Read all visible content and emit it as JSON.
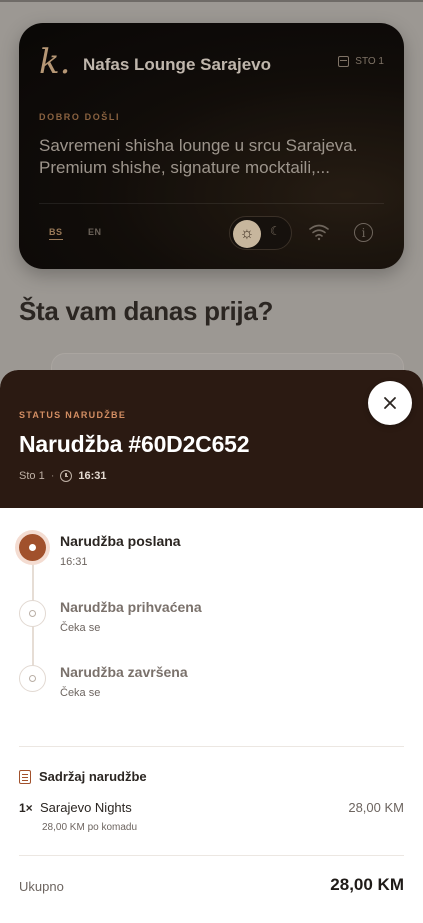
{
  "venue": {
    "logo": "k.",
    "name": "Nafas Lounge Sarajevo",
    "table_tag": "STO 1",
    "welcome_eyebrow": "DOBRO DOŠLI",
    "description": "Savremeni shisha lounge u srcu Sarajeva. Premium shishe, signature mocktaili,...",
    "languages": [
      "BS",
      "EN"
    ],
    "active_language": "BS",
    "theme": "light"
  },
  "page": {
    "heading": "Šta vam danas prija?"
  },
  "order": {
    "eyebrow": "STATUS NARUDŽBE",
    "title": "Narudžba #60D2C652",
    "table": "Sto 1",
    "separator": "·",
    "time": "16:31",
    "steps": [
      {
        "title": "Narudžba poslana",
        "sub": "16:31",
        "state": "done"
      },
      {
        "title": "Narudžba prihvaćena",
        "sub": "Čeka se",
        "state": "pending"
      },
      {
        "title": "Narudžba završena",
        "sub": "Čeka se",
        "state": "pending"
      }
    ],
    "contents_label": "Sadržaj narudžbe",
    "items": [
      {
        "qty": "1×",
        "name": "Sarajevo Nights",
        "price": "28,00 KM",
        "unit": "28,00 KM po komadu"
      }
    ],
    "total_label": "Ukupno",
    "total_value": "28,00 KM"
  },
  "colors": {
    "accent": "#a1512c",
    "header_bg": "#2b1a12",
    "eyebrow": "#d38e63"
  }
}
